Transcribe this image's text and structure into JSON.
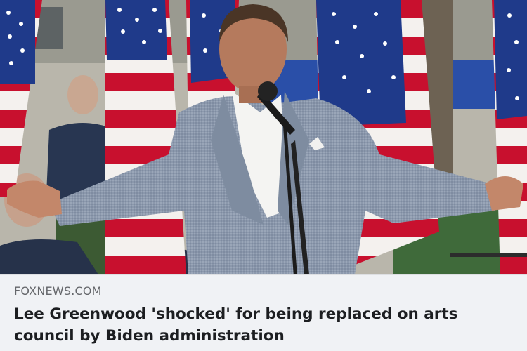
{
  "link_preview": {
    "image": {
      "alt": "Lee Greenwood 'shocked' for being replaced on arts council by Biden administration",
      "icon": "photo-image"
    },
    "domain": "FOXNEWS.COM",
    "headline": "Lee Greenwood 'shocked' for being replaced on arts council by Biden administration"
  },
  "colors": {
    "card_background": "#f0f2f5",
    "domain_text": "#65676b",
    "headline_text": "#1c1e21",
    "flag_red": "#c8102e",
    "flag_blue": "#1f3a8a",
    "jacket": "#8a97ab"
  }
}
